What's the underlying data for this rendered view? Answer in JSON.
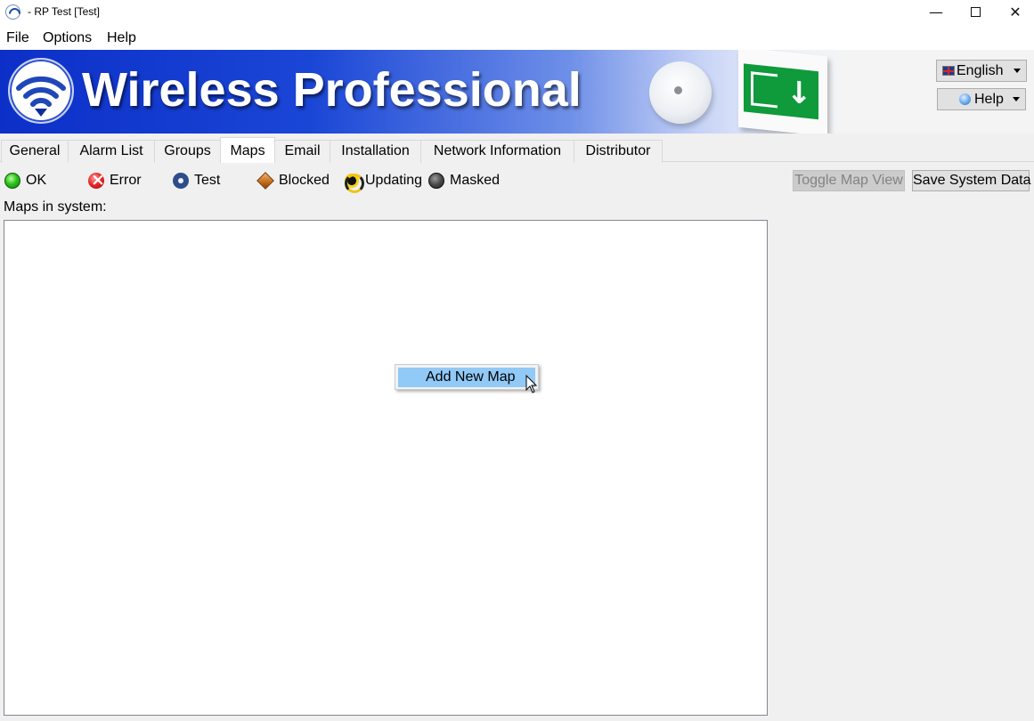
{
  "window": {
    "title": "- RP Test [Test]",
    "controls": {
      "minimize": "—",
      "close": "✕"
    }
  },
  "menu": {
    "file": "File",
    "options": "Options",
    "help": "Help"
  },
  "banner": {
    "title": "Wireless Professional",
    "language": "English",
    "help": "Help"
  },
  "tabs": [
    {
      "label": "General"
    },
    {
      "label": "Alarm List"
    },
    {
      "label": "Groups"
    },
    {
      "label": "Maps"
    },
    {
      "label": "Email"
    },
    {
      "label": "Installation"
    },
    {
      "label": "Network Information"
    },
    {
      "label": "Distributor"
    }
  ],
  "active_tab": "Maps",
  "legend": [
    {
      "label": "OK",
      "icon": "green-circle-icon",
      "color": "#2ec21f"
    },
    {
      "label": "Error",
      "icon": "red-x-circle-icon",
      "color": "#e02424"
    },
    {
      "label": "Test",
      "icon": "gear-icon",
      "color": "#2d4d8a"
    },
    {
      "label": "Blocked",
      "icon": "orange-diamond-icon",
      "color": "#c36a17"
    },
    {
      "label": "Updating",
      "icon": "refresh-arrows-icon",
      "color": "#f1c40f"
    },
    {
      "label": "Masked",
      "icon": "grey-circle-icon",
      "color": "#4a4a4a"
    }
  ],
  "buttons": {
    "toggle_map_view": "Toggle Map View",
    "save_system_data": "Save System Data"
  },
  "maps": {
    "label": "Maps in system:"
  },
  "context_menu": {
    "add_new_map": "Add New Map"
  }
}
